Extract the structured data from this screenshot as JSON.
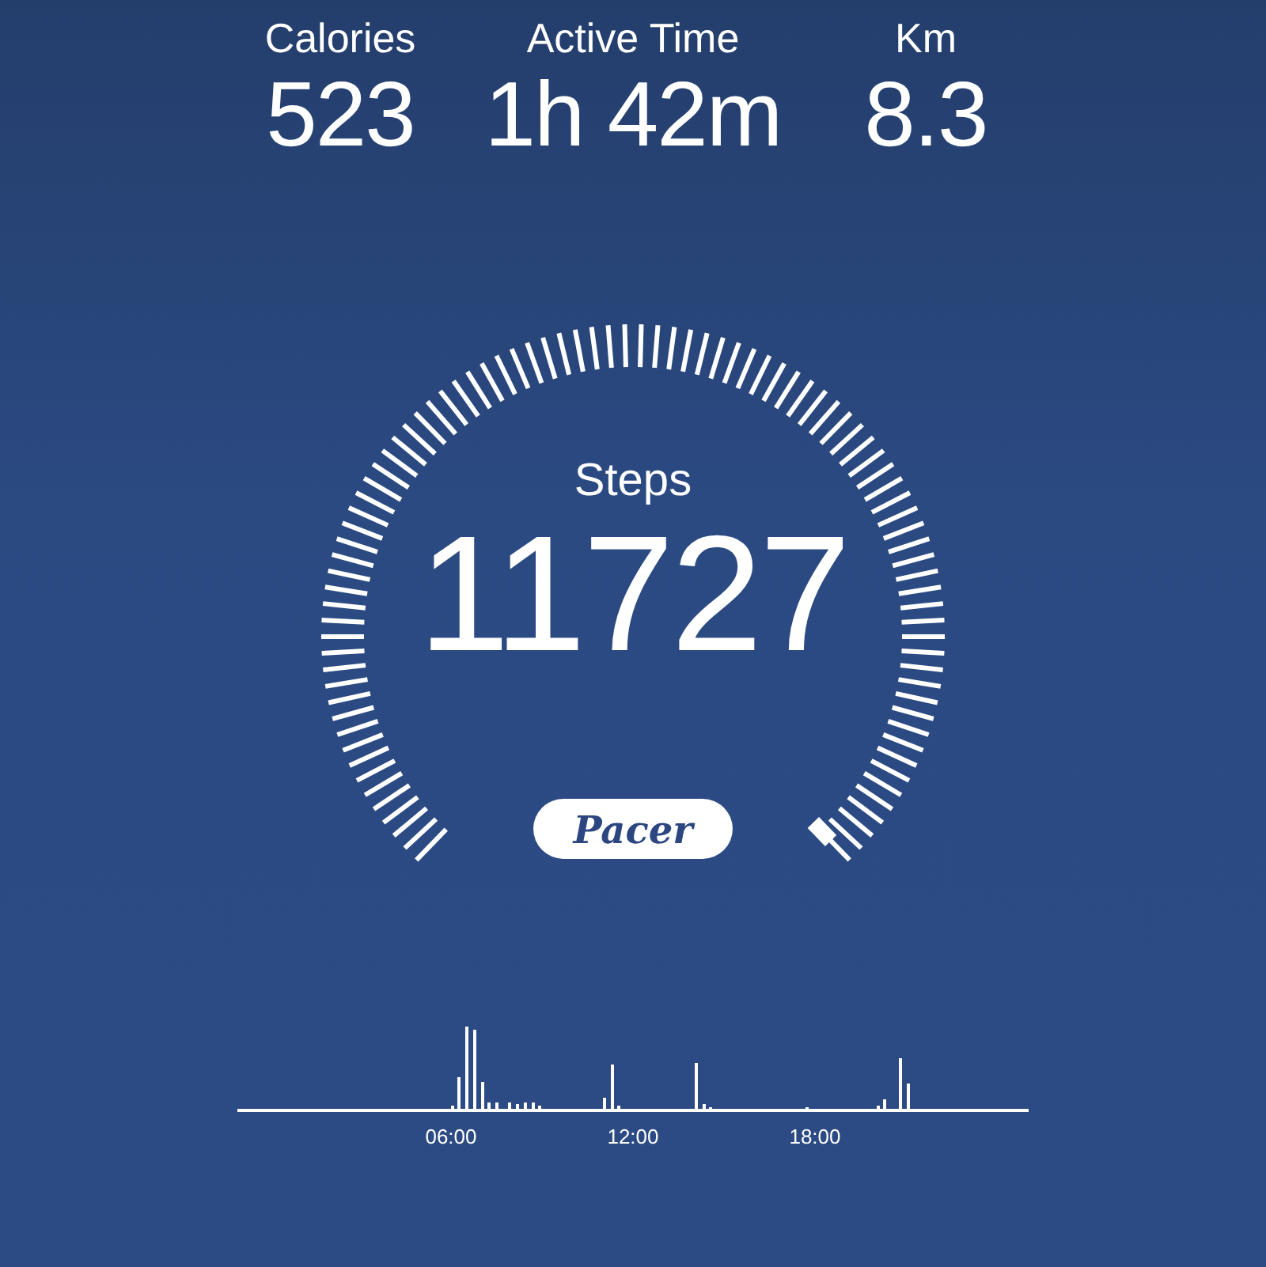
{
  "stats": [
    {
      "label": "Calories",
      "value": "523"
    },
    {
      "label": "Active Time",
      "value": "1h 42m"
    },
    {
      "label": "Km",
      "value": "8.3"
    }
  ],
  "gauge": {
    "label": "Steps",
    "value": "11727"
  },
  "logo": "Pacer",
  "activity_chart": {
    "xticks": [
      "06:00",
      "12:00",
      "18:00"
    ]
  }
}
